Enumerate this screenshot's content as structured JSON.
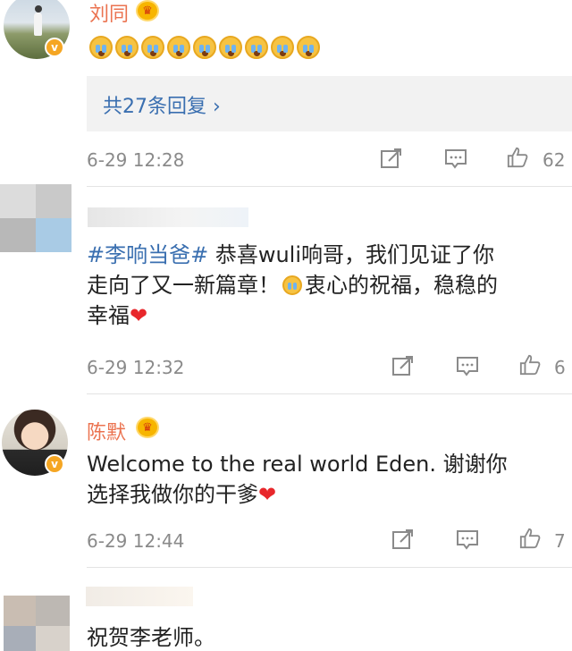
{
  "comments": [
    {
      "username": "刘同",
      "emoji_count": 9,
      "emoji_name": "crying-emoji",
      "replies_label": "共27条回复",
      "replies_chevron": "›",
      "time": "6-29 12:28",
      "likes": "62"
    },
    {
      "hashtag": "#李响当爸#",
      "text_line1": " 恭喜wuli响哥，我们见证了你",
      "text_line2a": "走向了又一新篇章！",
      "text_line2b": "衷心的祝福，稳稳的",
      "text_line3": "幸福",
      "heart": "❤",
      "time": "6-29 12:32",
      "likes": "6"
    },
    {
      "username": "陈默",
      "text_line1": "Welcome to the real world Eden. 谢谢你",
      "text_line2": "选择我做你的干爹",
      "heart": "❤",
      "time": "6-29 12:44",
      "likes": "7"
    },
    {
      "text": "祝贺李老师。"
    }
  ],
  "badges": {
    "verified_symbol": "v",
    "crown_symbol": "♛"
  },
  "colors": {
    "username": "#eb7350",
    "link": "#3a6fb0",
    "meta": "#8a8a8a",
    "reply_bg": "#f2f2f2"
  }
}
